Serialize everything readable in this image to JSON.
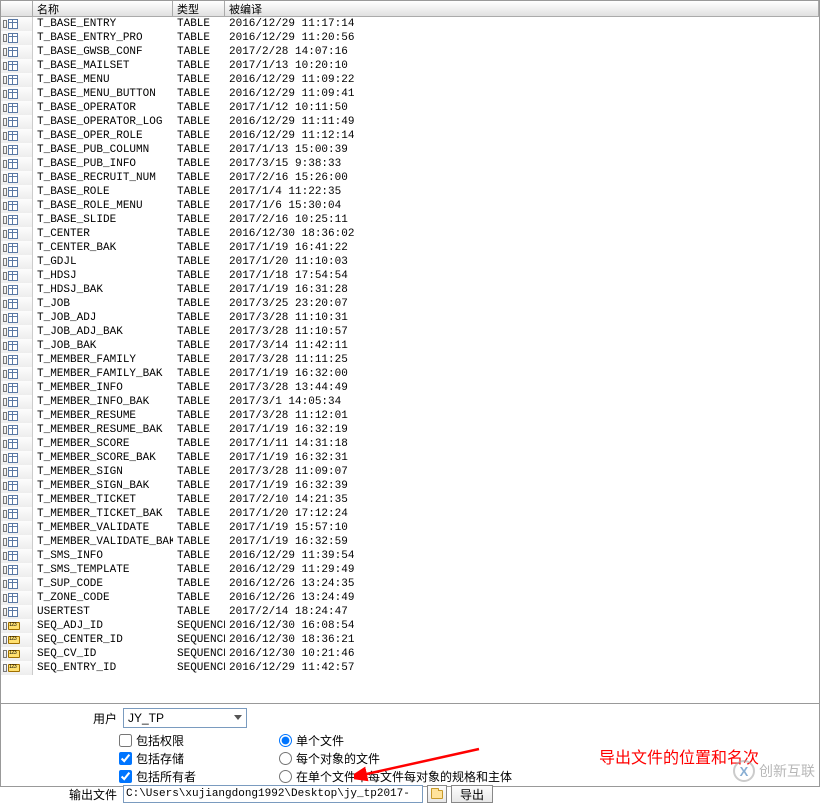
{
  "columns": {
    "name": "名称",
    "type": "类型",
    "compiled": "被编译"
  },
  "rows": [
    {
      "name": "T_BASE_ENTRY",
      "type": "TABLE",
      "compiled": "2016/12/29 11:17:14",
      "icon": "table"
    },
    {
      "name": "T_BASE_ENTRY_PRO",
      "type": "TABLE",
      "compiled": "2016/12/29 11:20:56",
      "icon": "table"
    },
    {
      "name": "T_BASE_GWSB_CONF",
      "type": "TABLE",
      "compiled": "2017/2/28 14:07:16",
      "icon": "table"
    },
    {
      "name": "T_BASE_MAILSET",
      "type": "TABLE",
      "compiled": "2017/1/13 10:20:10",
      "icon": "table"
    },
    {
      "name": "T_BASE_MENU",
      "type": "TABLE",
      "compiled": "2016/12/29 11:09:22",
      "icon": "table"
    },
    {
      "name": "T_BASE_MENU_BUTTON",
      "type": "TABLE",
      "compiled": "2016/12/29 11:09:41",
      "icon": "table"
    },
    {
      "name": "T_BASE_OPERATOR",
      "type": "TABLE",
      "compiled": "2017/1/12 10:11:50",
      "icon": "table"
    },
    {
      "name": "T_BASE_OPERATOR_LOG",
      "type": "TABLE",
      "compiled": "2016/12/29 11:11:49",
      "icon": "table"
    },
    {
      "name": "T_BASE_OPER_ROLE",
      "type": "TABLE",
      "compiled": "2016/12/29 11:12:14",
      "icon": "table"
    },
    {
      "name": "T_BASE_PUB_COLUMN",
      "type": "TABLE",
      "compiled": "2017/1/13 15:00:39",
      "icon": "table"
    },
    {
      "name": "T_BASE_PUB_INFO",
      "type": "TABLE",
      "compiled": "2017/3/15 9:38:33",
      "icon": "table"
    },
    {
      "name": "T_BASE_RECRUIT_NUM",
      "type": "TABLE",
      "compiled": "2017/2/16 15:26:00",
      "icon": "table"
    },
    {
      "name": "T_BASE_ROLE",
      "type": "TABLE",
      "compiled": "2017/1/4 11:22:35",
      "icon": "table"
    },
    {
      "name": "T_BASE_ROLE_MENU",
      "type": "TABLE",
      "compiled": "2017/1/6 15:30:04",
      "icon": "table"
    },
    {
      "name": "T_BASE_SLIDE",
      "type": "TABLE",
      "compiled": "2017/2/16 10:25:11",
      "icon": "table"
    },
    {
      "name": "T_CENTER",
      "type": "TABLE",
      "compiled": "2016/12/30 18:36:02",
      "icon": "table"
    },
    {
      "name": "T_CENTER_BAK",
      "type": "TABLE",
      "compiled": "2017/1/19 16:41:22",
      "icon": "table"
    },
    {
      "name": "T_GDJL",
      "type": "TABLE",
      "compiled": "2017/1/20 11:10:03",
      "icon": "table"
    },
    {
      "name": "T_HDSJ",
      "type": "TABLE",
      "compiled": "2017/1/18 17:54:54",
      "icon": "table"
    },
    {
      "name": "T_HDSJ_BAK",
      "type": "TABLE",
      "compiled": "2017/1/19 16:31:28",
      "icon": "table"
    },
    {
      "name": "T_JOB",
      "type": "TABLE",
      "compiled": "2017/3/25 23:20:07",
      "icon": "table"
    },
    {
      "name": "T_JOB_ADJ",
      "type": "TABLE",
      "compiled": "2017/3/28 11:10:31",
      "icon": "table"
    },
    {
      "name": "T_JOB_ADJ_BAK",
      "type": "TABLE",
      "compiled": "2017/3/28 11:10:57",
      "icon": "table"
    },
    {
      "name": "T_JOB_BAK",
      "type": "TABLE",
      "compiled": "2017/3/14 11:42:11",
      "icon": "table"
    },
    {
      "name": "T_MEMBER_FAMILY",
      "type": "TABLE",
      "compiled": "2017/3/28 11:11:25",
      "icon": "table"
    },
    {
      "name": "T_MEMBER_FAMILY_BAK",
      "type": "TABLE",
      "compiled": "2017/1/19 16:32:00",
      "icon": "table"
    },
    {
      "name": "T_MEMBER_INFO",
      "type": "TABLE",
      "compiled": "2017/3/28 13:44:49",
      "icon": "table"
    },
    {
      "name": "T_MEMBER_INFO_BAK",
      "type": "TABLE",
      "compiled": "2017/3/1 14:05:34",
      "icon": "table"
    },
    {
      "name": "T_MEMBER_RESUME",
      "type": "TABLE",
      "compiled": "2017/3/28 11:12:01",
      "icon": "table"
    },
    {
      "name": "T_MEMBER_RESUME_BAK",
      "type": "TABLE",
      "compiled": "2017/1/19 16:32:19",
      "icon": "table"
    },
    {
      "name": "T_MEMBER_SCORE",
      "type": "TABLE",
      "compiled": "2017/1/11 14:31:18",
      "icon": "table"
    },
    {
      "name": "T_MEMBER_SCORE_BAK",
      "type": "TABLE",
      "compiled": "2017/1/19 16:32:31",
      "icon": "table"
    },
    {
      "name": "T_MEMBER_SIGN",
      "type": "TABLE",
      "compiled": "2017/3/28 11:09:07",
      "icon": "table"
    },
    {
      "name": "T_MEMBER_SIGN_BAK",
      "type": "TABLE",
      "compiled": "2017/1/19 16:32:39",
      "icon": "table"
    },
    {
      "name": "T_MEMBER_TICKET",
      "type": "TABLE",
      "compiled": "2017/2/10 14:21:35",
      "icon": "table"
    },
    {
      "name": "T_MEMBER_TICKET_BAK",
      "type": "TABLE",
      "compiled": "2017/1/20 17:12:24",
      "icon": "table"
    },
    {
      "name": "T_MEMBER_VALIDATE",
      "type": "TABLE",
      "compiled": "2017/1/19 15:57:10",
      "icon": "table"
    },
    {
      "name": "T_MEMBER_VALIDATE_BAK",
      "type": "TABLE",
      "compiled": "2017/1/19 16:32:59",
      "icon": "table"
    },
    {
      "name": "T_SMS_INFO",
      "type": "TABLE",
      "compiled": "2016/12/29 11:39:54",
      "icon": "table"
    },
    {
      "name": "T_SMS_TEMPLATE",
      "type": "TABLE",
      "compiled": "2016/12/29 11:29:49",
      "icon": "table"
    },
    {
      "name": "T_SUP_CODE",
      "type": "TABLE",
      "compiled": "2016/12/26 13:24:35",
      "icon": "table"
    },
    {
      "name": "T_ZONE_CODE",
      "type": "TABLE",
      "compiled": "2016/12/26 13:24:49",
      "icon": "table"
    },
    {
      "name": "USERTEST",
      "type": "TABLE",
      "compiled": "2017/2/14 18:24:47",
      "icon": "table"
    },
    {
      "name": "SEQ_ADJ_ID",
      "type": "SEQUENCE",
      "compiled": "2016/12/30 16:08:54",
      "icon": "seq"
    },
    {
      "name": "SEQ_CENTER_ID",
      "type": "SEQUENCE",
      "compiled": "2016/12/30 18:36:21",
      "icon": "seq"
    },
    {
      "name": "SEQ_CV_ID",
      "type": "SEQUENCE",
      "compiled": "2016/12/30 10:21:46",
      "icon": "seq"
    },
    {
      "name": "SEQ_ENTRY_ID",
      "type": "SEQUENCE",
      "compiled": "2016/12/29 11:42:57",
      "icon": "seq"
    }
  ],
  "form": {
    "user_label": "用户",
    "user_value": "JY_TP",
    "include_priv": "包括权限",
    "include_storage": "包括存储",
    "include_owner": "包括所有者",
    "single_file": "单个文件",
    "file_per_object": "每个对象的文件",
    "spec_body_in_single": "在单个文件中每文件每对象的规格和主体",
    "output_label": "输出文件",
    "output_value": "C:\\Users\\xujiangdong1992\\Desktop\\jy_tp2017-",
    "export_btn": "导出"
  },
  "annotation": "导出文件的位置和名次",
  "logo": "创新互联"
}
